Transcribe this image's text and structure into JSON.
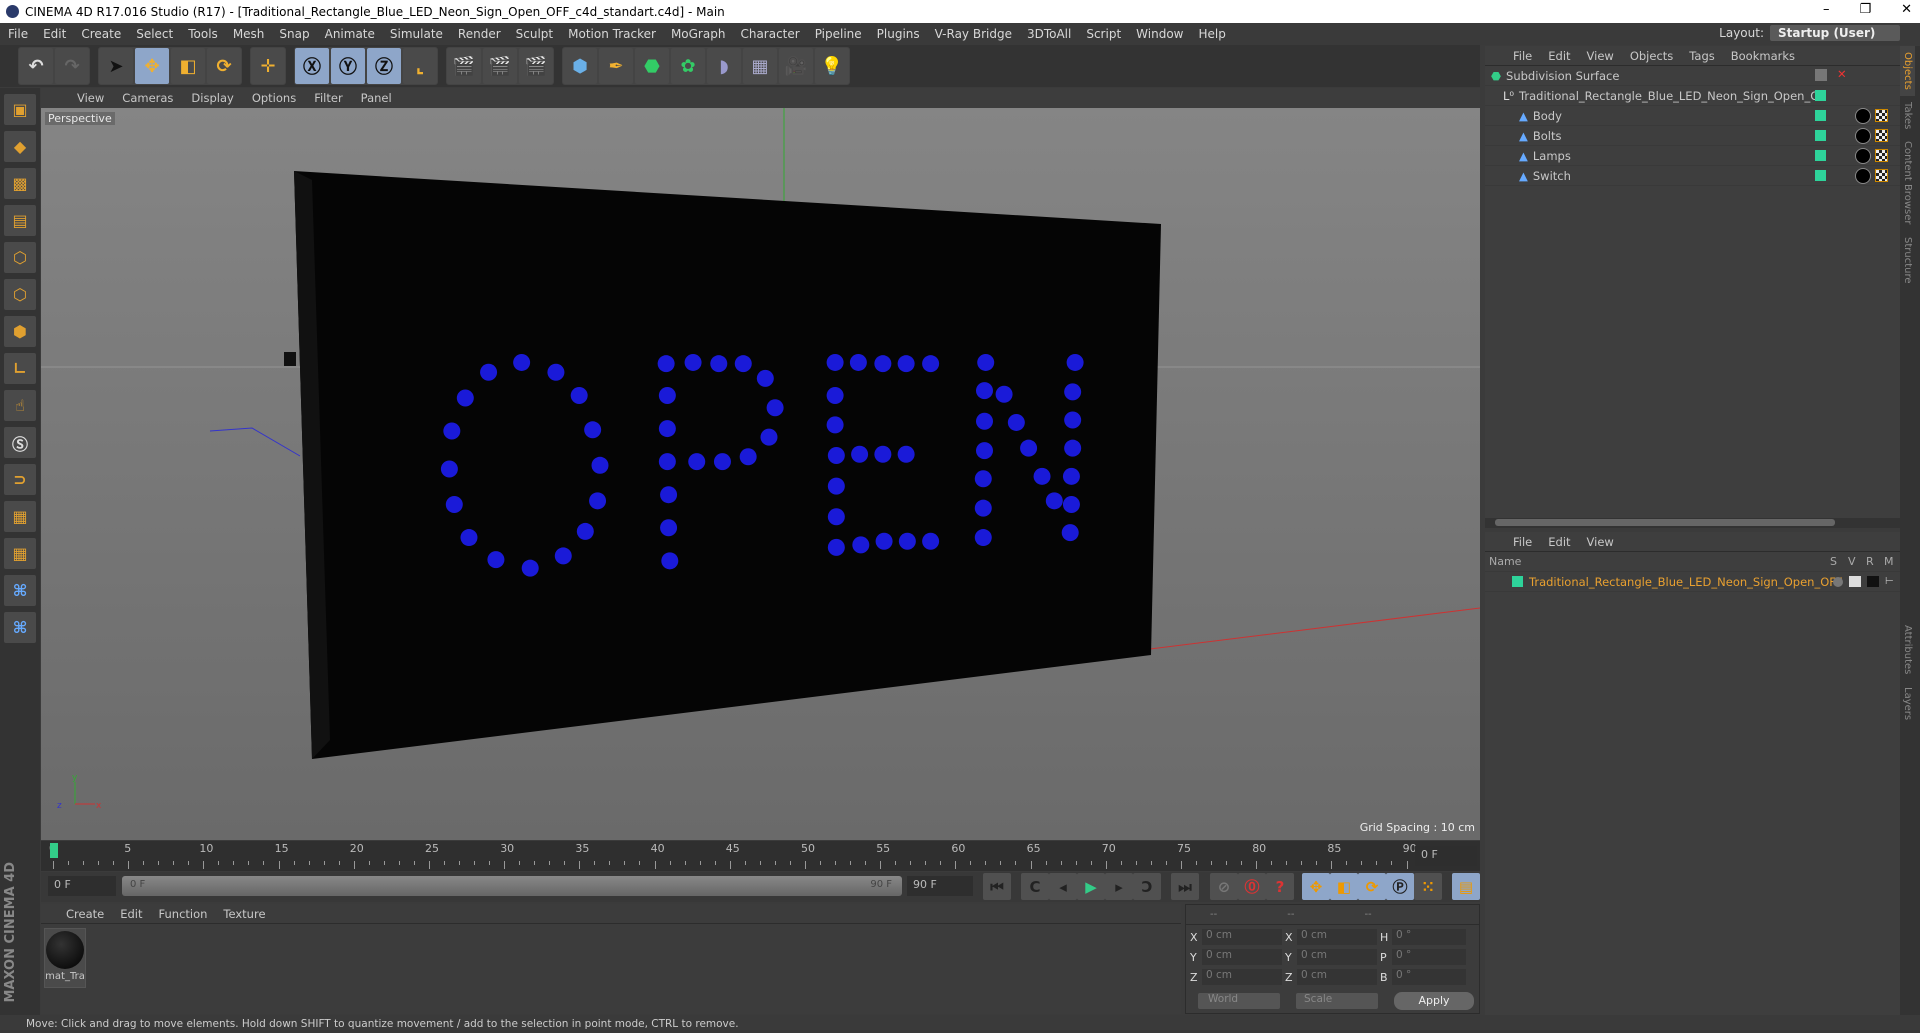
{
  "title": "CINEMA 4D R17.016 Studio (R17) - [Traditional_Rectangle_Blue_LED_Neon_Sign_Open_OFF_c4d_standart.c4d] - Main",
  "menu": [
    "File",
    "Edit",
    "Create",
    "Select",
    "Tools",
    "Mesh",
    "Snap",
    "Animate",
    "Simulate",
    "Render",
    "Sculpt",
    "Motion Tracker",
    "MoGraph",
    "Character",
    "Pipeline",
    "Plugins",
    "V-Ray Bridge",
    "3DToAll",
    "Script",
    "Window",
    "Help"
  ],
  "layout": {
    "label": "Layout:",
    "value": "Startup (User)"
  },
  "viewport": {
    "menu": [
      "View",
      "Cameras",
      "Display",
      "Options",
      "Filter",
      "Panel"
    ],
    "label": "Perspective",
    "grid_spacing": "Grid Spacing : 10 cm"
  },
  "timeline": {
    "ticks": [
      "0",
      "5",
      "10",
      "15",
      "20",
      "25",
      "30",
      "35",
      "40",
      "45",
      "50",
      "55",
      "60",
      "65",
      "70",
      "75",
      "80",
      "85",
      "90"
    ],
    "current": "0 F",
    "start": "0 F",
    "range_start": "0 F",
    "range_end": "90 F",
    "end": "90 F"
  },
  "materials": {
    "menu": [
      "Create",
      "Edit",
      "Function",
      "Texture"
    ],
    "items": [
      {
        "name": "mat_Tra"
      }
    ]
  },
  "coords": {
    "headers": [
      "--",
      "--",
      "--"
    ],
    "rows": [
      [
        "X",
        "0 cm",
        "X",
        "0 cm",
        "H",
        "0 °"
      ],
      [
        "Y",
        "0 cm",
        "Y",
        "0 cm",
        "P",
        "0 °"
      ],
      [
        "Z",
        "0 cm",
        "Z",
        "0 cm",
        "B",
        "0 °"
      ]
    ],
    "mode1": "World",
    "mode2": "Scale",
    "apply": "Apply"
  },
  "objects": {
    "menu": [
      "File",
      "Edit",
      "View",
      "Objects",
      "Tags",
      "Bookmarks"
    ],
    "items": [
      "Subdivision Surface",
      "Traditional_Rectangle_Blue_LED_Neon_Sign_Open_OF",
      "Body",
      "Bolts",
      "Lamps",
      "Switch"
    ]
  },
  "layers": {
    "menu": [
      "File",
      "Edit",
      "View"
    ],
    "cols": [
      "Name",
      "S",
      "V",
      "R",
      "M"
    ],
    "item": "Traditional_Rectangle_Blue_LED_Neon_Sign_Open_OFF"
  },
  "side_tabs": [
    "Objects",
    "Takes",
    "Content Browser",
    "Structure",
    "Attributes",
    "Layers"
  ],
  "brand": "MAXON CINEMA 4D",
  "status": "Move: Click and drag to move elements. Hold down SHIFT to quantize movement / add to the selection in point mode, CTRL to remove.",
  "colors": {
    "led": "#1a1ad8",
    "tag": "#2ed39a",
    "accent": "#8ea6c9"
  }
}
